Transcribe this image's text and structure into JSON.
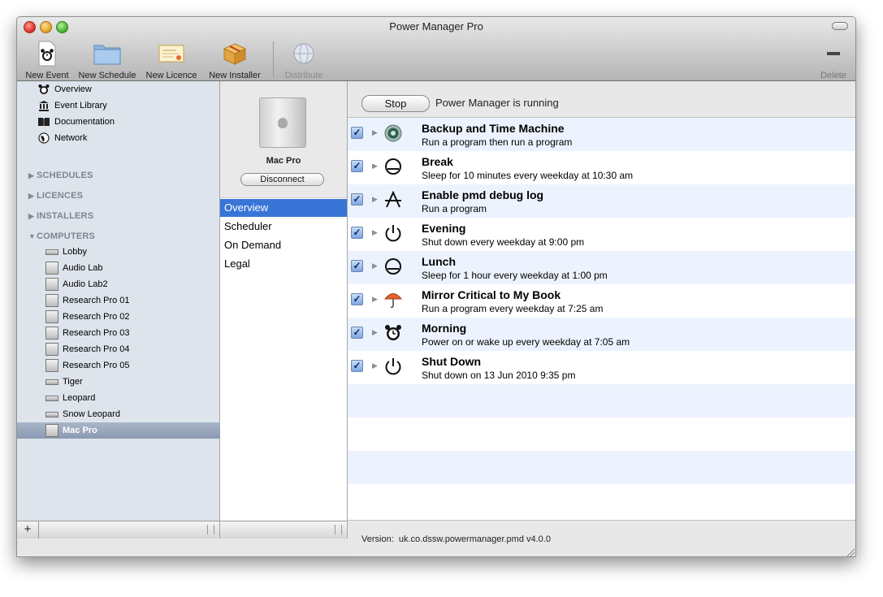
{
  "window": {
    "title": "Power Manager Pro"
  },
  "toolbar": {
    "items": [
      {
        "label": "New Event",
        "icon": "alarm-clock-document-icon"
      },
      {
        "label": "New Schedule",
        "icon": "folder-icon"
      },
      {
        "label": "New Licence",
        "icon": "licence-certificate-icon"
      },
      {
        "label": "New Installer",
        "icon": "package-box-icon"
      },
      {
        "label": "Distribute",
        "icon": "globe-icon",
        "disabled": true
      }
    ],
    "delete_label": "Delete"
  },
  "sidebar": {
    "top_items": [
      {
        "label": "Overview",
        "icon": "alarm-clock-icon"
      },
      {
        "label": "Event Library",
        "icon": "library-building-icon"
      },
      {
        "label": "Documentation",
        "icon": "book-icon"
      },
      {
        "label": "Network",
        "icon": "globe-icon"
      }
    ],
    "sections": {
      "schedules": "SCHEDULES",
      "licences": "LICENCES",
      "installers": "INSTALLERS",
      "computers": "COMPUTERS"
    },
    "computers": [
      {
        "label": "Lobby",
        "kind": "display"
      },
      {
        "label": "Audio Lab",
        "kind": "tower"
      },
      {
        "label": "Audio Lab2",
        "kind": "tower"
      },
      {
        "label": "Research Pro 01",
        "kind": "tower"
      },
      {
        "label": "Research Pro 02",
        "kind": "tower"
      },
      {
        "label": "Research Pro 03",
        "kind": "tower"
      },
      {
        "label": "Research Pro 04",
        "kind": "tower"
      },
      {
        "label": "Research Pro 05",
        "kind": "tower"
      },
      {
        "label": "Tiger",
        "kind": "display"
      },
      {
        "label": "Leopard",
        "kind": "display"
      },
      {
        "label": "Snow Leopard",
        "kind": "display"
      },
      {
        "label": "Mac Pro",
        "kind": "tower",
        "selected": true
      }
    ],
    "add_button": "+"
  },
  "computer_panel": {
    "name": "Mac Pro",
    "disconnect_label": "Disconnect",
    "nav": [
      "Overview",
      "Scheduler",
      "On Demand",
      "Legal"
    ],
    "selected_nav": "Overview"
  },
  "main": {
    "stop_label": "Stop",
    "status": "Power Manager is running",
    "events": [
      {
        "title": "Backup and Time Machine",
        "desc": "Run a program then run a program",
        "icon": "time-machine-icon",
        "checked": true
      },
      {
        "title": "Break",
        "desc": "Sleep for 10 minutes every weekday at 10:30 am",
        "icon": "sleep-icon",
        "checked": true
      },
      {
        "title": "Enable pmd debug log",
        "desc": "Run a program",
        "icon": "script-a-icon",
        "checked": true
      },
      {
        "title": "Evening",
        "desc": "Shut down every weekday at 9:00 pm",
        "icon": "power-icon",
        "checked": true
      },
      {
        "title": "Lunch",
        "desc": "Sleep for 1 hour every weekday at 1:00 pm",
        "icon": "sleep-icon",
        "checked": true
      },
      {
        "title": "Mirror Critical to My Book",
        "desc": "Run a program every weekday at 7:25 am",
        "icon": "umbrella-icon",
        "checked": true
      },
      {
        "title": "Morning",
        "desc": "Power on or wake up every weekday at 7:05 am",
        "icon": "alarm-clock-icon",
        "checked": true
      },
      {
        "title": "Shut Down",
        "desc": "Shut down on 13 Jun 2010 9:35 pm",
        "icon": "power-icon",
        "checked": true
      }
    ],
    "version_label": "Version:",
    "version_value": "uk.co.dssw.powermanager.pmd v4.0.0"
  }
}
